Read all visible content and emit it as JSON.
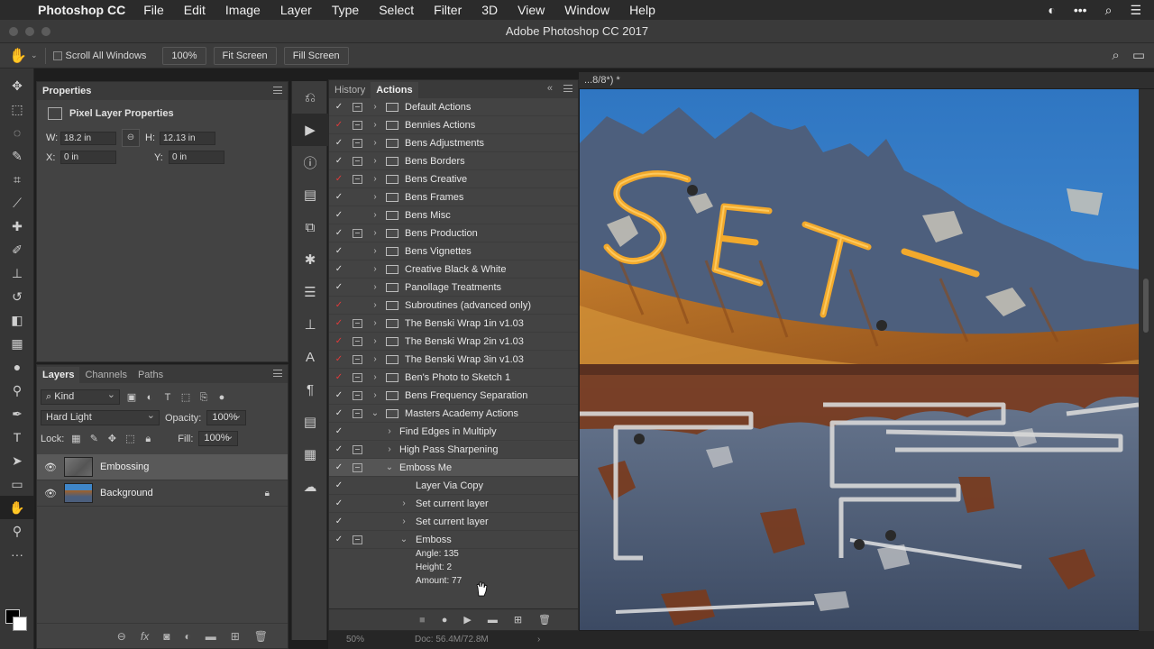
{
  "menubar": {
    "app_name": "Photoshop CC",
    "items": [
      "File",
      "Edit",
      "Image",
      "Layer",
      "Type",
      "Select",
      "Filter",
      "3D",
      "View",
      "Window",
      "Help"
    ],
    "right_icons": [
      "user-circle-icon",
      "more-dots-icon",
      "spotlight-search-icon",
      "menu-list-icon"
    ]
  },
  "window": {
    "title": "Adobe Photoshop CC 2017"
  },
  "options_bar": {
    "scroll_all_label": "Scroll All Windows",
    "zoom_button": "100%",
    "fit_button": "Fit Screen",
    "fill_button": "Fill Screen"
  },
  "properties": {
    "tab": "Properties",
    "heading": "Pixel Layer Properties",
    "w_label": "W:",
    "w_value": "18.2 in",
    "h_label": "H:",
    "h_value": "12.13 in",
    "x_label": "X:",
    "x_value": "0 in",
    "y_label": "Y:",
    "y_value": "0 in"
  },
  "layers_panel": {
    "tabs": [
      "Layers",
      "Channels",
      "Paths"
    ],
    "filter_kind": "Kind",
    "blend_mode": "Hard Light",
    "opacity_label": "Opacity:",
    "opacity_value": "100%",
    "lock_label": "Lock:",
    "fill_label": "Fill:",
    "fill_value": "100%",
    "layers": [
      {
        "name": "Embossing",
        "selected": true
      },
      {
        "name": "Background",
        "selected": false,
        "locked": true
      }
    ]
  },
  "actions_panel": {
    "tabs": [
      "History",
      "Actions"
    ],
    "items": [
      {
        "name": "Default Actions",
        "check": "white",
        "dialog": true,
        "level": 0,
        "type": "set",
        "expanded": false
      },
      {
        "name": "Bennies Actions",
        "check": "red",
        "dialog": true,
        "level": 0,
        "type": "set",
        "expanded": false
      },
      {
        "name": "Bens Adjustments",
        "check": "white",
        "dialog": true,
        "level": 0,
        "type": "set",
        "expanded": false
      },
      {
        "name": "Bens Borders",
        "check": "white",
        "dialog": true,
        "level": 0,
        "type": "set",
        "expanded": false
      },
      {
        "name": "Bens Creative",
        "check": "red",
        "dialog": true,
        "level": 0,
        "type": "set",
        "expanded": false
      },
      {
        "name": "Bens Frames",
        "check": "white",
        "dialog": false,
        "level": 0,
        "type": "set",
        "expanded": false
      },
      {
        "name": "Bens Misc",
        "check": "white",
        "dialog": false,
        "level": 0,
        "type": "set",
        "expanded": false
      },
      {
        "name": "Bens Production",
        "check": "white",
        "dialog": true,
        "level": 0,
        "type": "set",
        "expanded": false
      },
      {
        "name": "Bens Vignettes",
        "check": "white",
        "dialog": false,
        "level": 0,
        "type": "set",
        "expanded": false
      },
      {
        "name": "Creative Black & White",
        "check": "white",
        "dialog": false,
        "level": 0,
        "type": "set",
        "expanded": false
      },
      {
        "name": "Panollage Treatments",
        "check": "white",
        "dialog": false,
        "level": 0,
        "type": "set",
        "expanded": false
      },
      {
        "name": "Subroutines (advanced only)",
        "check": "red",
        "dialog": false,
        "level": 0,
        "type": "set",
        "expanded": false
      },
      {
        "name": "The Benski Wrap 1in v1.03",
        "check": "red",
        "dialog": true,
        "level": 0,
        "type": "set",
        "expanded": false
      },
      {
        "name": "The Benski Wrap 2in v1.03",
        "check": "red",
        "dialog": true,
        "level": 0,
        "type": "set",
        "expanded": false
      },
      {
        "name": "The Benski Wrap 3in v1.03",
        "check": "red",
        "dialog": true,
        "level": 0,
        "type": "set",
        "expanded": false
      },
      {
        "name": "Ben's Photo to Sketch 1",
        "check": "red",
        "dialog": true,
        "level": 0,
        "type": "set",
        "expanded": false
      },
      {
        "name": "Bens Frequency Separation",
        "check": "white",
        "dialog": true,
        "level": 0,
        "type": "set",
        "expanded": false
      },
      {
        "name": "Masters Academy Actions",
        "check": "white",
        "dialog": true,
        "level": 0,
        "type": "set",
        "expanded": true
      },
      {
        "name": "Find Edges in Multiply",
        "check": "white",
        "dialog": false,
        "level": 1,
        "type": "action",
        "expanded": false
      },
      {
        "name": "High Pass Sharpening",
        "check": "white",
        "dialog": true,
        "level": 1,
        "type": "action",
        "expanded": false
      },
      {
        "name": "Emboss Me",
        "check": "white",
        "dialog": true,
        "level": 1,
        "type": "action",
        "expanded": true,
        "highlight": true
      },
      {
        "name": "Layer Via Copy",
        "check": "white",
        "dialog": false,
        "level": 2,
        "type": "step",
        "expanded": null
      },
      {
        "name": "Set current layer",
        "check": "white",
        "dialog": false,
        "level": 2,
        "type": "step",
        "expanded": false
      },
      {
        "name": "Set current layer",
        "check": "white",
        "dialog": false,
        "level": 2,
        "type": "step",
        "expanded": false
      },
      {
        "name": "Emboss",
        "check": "white",
        "dialog": true,
        "level": 2,
        "type": "step",
        "expanded": true
      }
    ],
    "params": [
      "Angle: 135",
      "Height: 2",
      "Amount: 77"
    ]
  },
  "document": {
    "tab_title": "...8/8*) *",
    "status_zoom": "50%",
    "status_doc": "Doc: 56.4M/72.8M"
  },
  "colors": {
    "accent_red_check": "#e03a3a",
    "panel_bg": "#434343",
    "sky": "#3f86c8",
    "rust": "#b5651d",
    "neon": "#f2a92c"
  }
}
